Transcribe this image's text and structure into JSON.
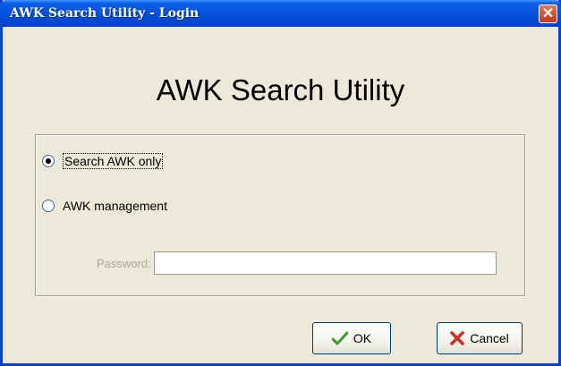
{
  "window": {
    "title": "AWK Search Utility - Login",
    "close_symbol": "✕"
  },
  "heading": "AWK Search Utility",
  "options": {
    "search_only": {
      "label": "Search AWK only",
      "checked": true
    },
    "management": {
      "label": "AWK management",
      "checked": false
    }
  },
  "password": {
    "label": "Password:",
    "value": ""
  },
  "buttons": {
    "ok": {
      "label": "OK",
      "icon": "checkmark-icon"
    },
    "cancel": {
      "label": "Cancel",
      "icon": "x-icon"
    }
  },
  "colors": {
    "titlebar": "#0551e0",
    "checkmark": "#3a9b25",
    "cancel_x": "#d22b1f"
  }
}
